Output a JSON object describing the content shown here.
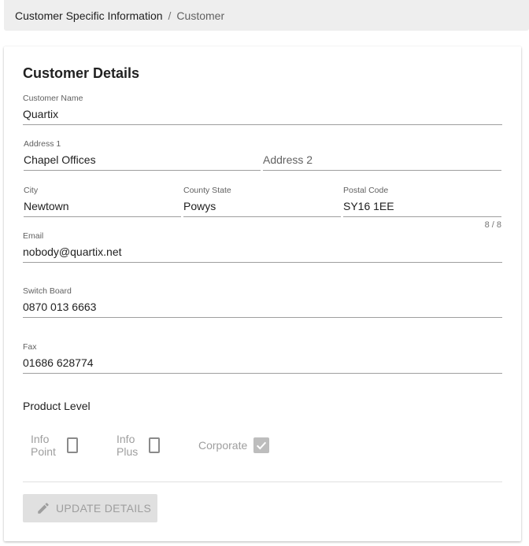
{
  "breadcrumb": {
    "parent": "Customer Specific Information",
    "separator": "/",
    "current": "Customer"
  },
  "card": {
    "title": "Customer Details"
  },
  "fields": {
    "customer_name": {
      "label": "Customer Name",
      "value": "Quartix"
    },
    "address1": {
      "label": "Address 1",
      "value": "Chapel Offices"
    },
    "address2": {
      "placeholder": "Address 2"
    },
    "city": {
      "label": "City",
      "value": "Newtown"
    },
    "county_state": {
      "label": "County State",
      "value": "Powys"
    },
    "postal_code": {
      "label": "Postal Code",
      "value": "SY16 1EE",
      "counter": "8 / 8"
    },
    "email": {
      "label": "Email",
      "value": "nobody@quartix.net"
    },
    "switch_board": {
      "label": "Switch Board",
      "value": "0870 013 6663"
    },
    "fax": {
      "label": "Fax",
      "value": "01686 628774"
    }
  },
  "product_level": {
    "label": "Product Level",
    "options": [
      {
        "label": "Info Point",
        "checked": false
      },
      {
        "label": "Info Plus",
        "checked": false
      },
      {
        "label": "Corporate",
        "checked": true
      }
    ]
  },
  "actions": {
    "update_label": "UPDATE DETAILS",
    "update_icon": "pencil-icon",
    "enabled": false
  },
  "colors": {
    "breadcrumb_bg": "#eeeeee",
    "text_primary": "#212121",
    "text_secondary": "#616161",
    "disabled": "#9e9e9e",
    "button_disabled_bg": "#e0e0e0"
  }
}
